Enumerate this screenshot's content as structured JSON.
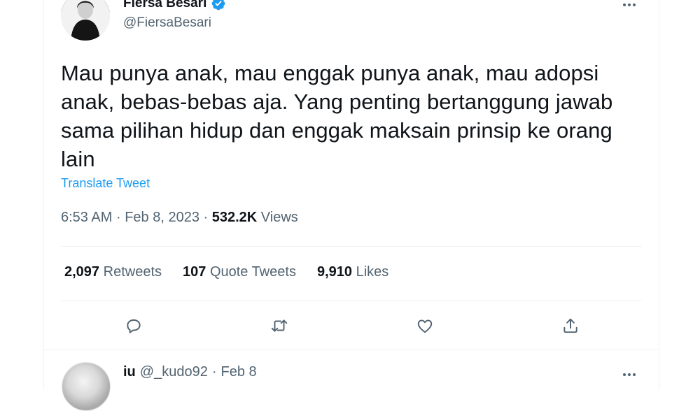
{
  "author": {
    "name": "Fiersa Besari",
    "handle": "@FiersaBesari",
    "verified_color": "#1d9bf0"
  },
  "tweet": {
    "text": "Mau punya anak, mau enggak punya anak, mau adopsi anak, bebas-bebas aja. Yang penting bertanggung jawab sama pilihan hidup dan enggak maksain prinsip ke orang lain",
    "translate_label": "Translate Tweet",
    "time": "6:53 AM",
    "separator": "·",
    "date": "Feb 8, 2023",
    "views_count": "532.2K",
    "views_label": "Views"
  },
  "stats": {
    "retweets_count": "2,097",
    "retweets_label": "Retweets",
    "quotes_count": "107",
    "quotes_label": "Quote Tweets",
    "likes_count": "9,910",
    "likes_label": "Likes"
  },
  "actions": [
    "reply-icon",
    "retweet-icon",
    "like-icon",
    "share-icon"
  ],
  "reply": {
    "name": "iu",
    "handle": "@_kudo92",
    "separator": "·",
    "date": "Feb 8"
  },
  "colors": {
    "accent": "#1d9bf0",
    "text": "#0f1419",
    "muted": "#536471",
    "divider": "#eff3f4"
  }
}
